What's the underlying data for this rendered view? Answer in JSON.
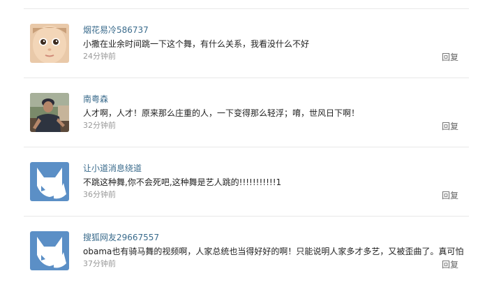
{
  "comments": [
    {
      "username": "烟花易冷586737",
      "content": "小撒在业余时间跳一下这个舞，有什么关系，我看没什么不好",
      "time": "24分钟前",
      "reply": "回复",
      "avatar": "baby-photo"
    },
    {
      "username": "南粤森",
      "content": "人才啊，人才！原来那么庄重的人，一下变得那么轻浮；唷，世风日下啊！",
      "time": "32分钟前",
      "reply": "回复",
      "avatar": "person-photo"
    },
    {
      "username": "让小道消息绕道",
      "content": "不跳这种舞,你不会死吧,这种舞是艺人跳的!!!!!!!!!!!1",
      "time": "36分钟前",
      "reply": "回复",
      "avatar": "default-fox-avatar"
    },
    {
      "username": "搜狐网友29667557",
      "content": "obama也有骑马舞的视频啊，人家总统也当得好好的啊！只能说明人家多才多艺，又被歪曲了。真可怕",
      "time": "37分钟前",
      "reply": "回复",
      "avatar": "default-fox-avatar"
    }
  ],
  "colors": {
    "username": "#3a6b8c",
    "text": "#222222",
    "time": "#999999",
    "reply": "#666666",
    "divider": "#e8e8e8",
    "default_avatar_bg": "#5b8fc6"
  }
}
